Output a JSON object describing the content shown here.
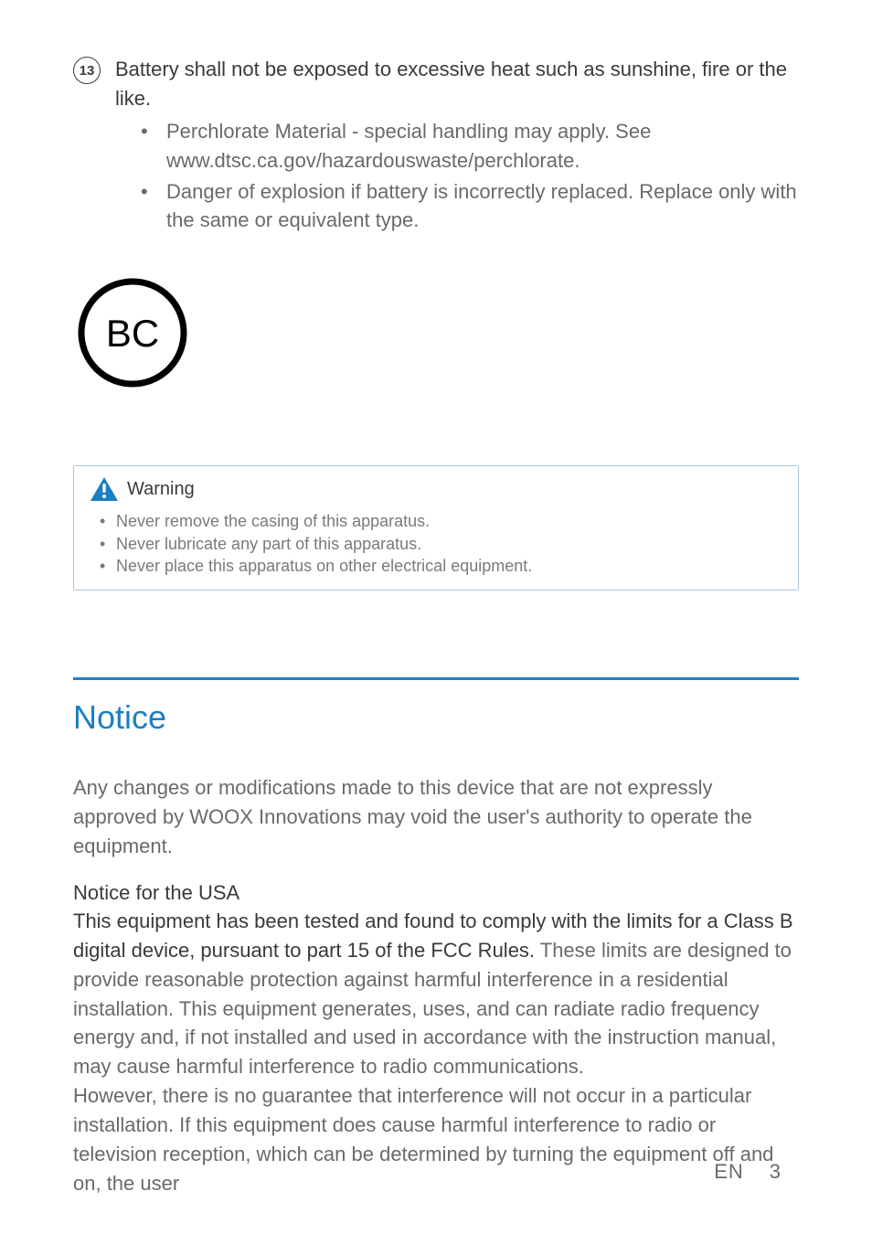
{
  "item": {
    "number": "13",
    "title": "Battery shall not be exposed to excessive heat such as sunshine, fire or the like.",
    "bullets": [
      "Perchlorate Material - special handling may apply. See www.dtsc.ca.gov/hazardouswaste/perchlorate.",
      "Danger of explosion if battery is incorrectly replaced. Replace only with the same or equivalent type."
    ]
  },
  "bc_label": "BC",
  "warning": {
    "title": "Warning",
    "items": [
      "Never remove the casing of this apparatus.",
      "Never lubricate any part of this apparatus.",
      "Never place this apparatus on other electrical equipment."
    ]
  },
  "notice": {
    "heading": "Notice",
    "intro": "Any changes or modifications made to this device that are not expressly approved by WOOX Innovations may void the user's authority to operate the equipment.",
    "usa_title": "Notice for the USA",
    "usa_bold": "This equipment has been tested and found to comply with the limits for a Class B digital device, pursuant to part 15 of the FCC Rules.",
    "usa_rest": " These limits are designed to provide reasonable protection against harmful interference in a residential installation. This equipment generates, uses, and can radiate radio frequency energy and, if not installed and used in accordance with the instruction manual, may cause harmful interference to radio communications.",
    "usa_para2": "However, there is no guarantee that interference will not occur in a particular installation. If this equipment does cause harmful interference to radio or television reception, which can be determined by turning the equipment off and on, the user"
  },
  "footer": {
    "lang": "EN",
    "page": "3"
  }
}
